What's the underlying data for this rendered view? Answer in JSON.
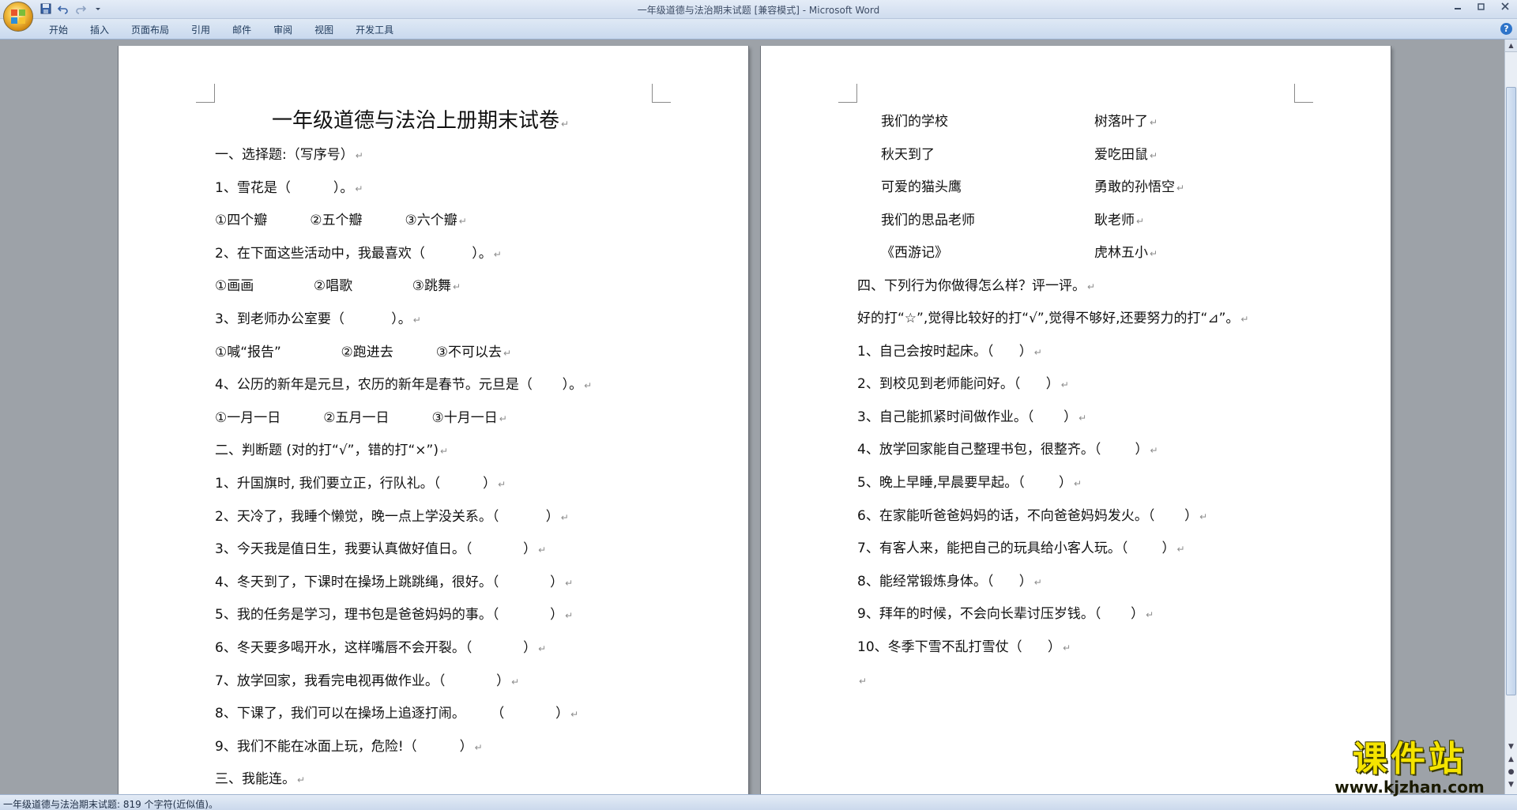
{
  "window": {
    "title": "一年级道德与法治期末试题 [兼容模式] - Microsoft Word",
    "help": "?"
  },
  "ribbon": {
    "tabs": [
      "开始",
      "插入",
      "页面布局",
      "引用",
      "邮件",
      "审阅",
      "视图",
      "开发工具"
    ]
  },
  "document": {
    "title": "一年级道德与法治上册期末试卷",
    "left_lines": [
      "一、选择题:（写序号）",
      "1、雪花是（          ）。",
      "①四个瓣          ②五个瓣          ③六个瓣",
      "2、在下面这些活动中，我最喜欢（           ）。",
      "①画画              ②唱歌              ③跳舞",
      "3、到老师办公室要（           ）。",
      "①喊“报告”              ②跑进去          ③不可以去",
      "4、公历的新年是元旦，农历的新年是春节。元旦是（       ）。",
      "①一月一日          ②五月一日          ③十月一日",
      "二、判断题 (对的打“√”，错的打“×”)",
      "1、升国旗时, 我们要立正，行队礼。（          ）",
      "2、天冷了，我睡个懒觉，晚一点上学没关系。（           ）",
      "3、今天我是值日生，我要认真做好值日。（            ）",
      "4、冬天到了，下课时在操场上跳跳绳，很好。（            ）",
      "5、我的任务是学习，理书包是爸爸妈妈的事。（            ）",
      "6、冬天要多喝开水，这样嘴唇不会开裂。（            ）",
      "7、放学回家，我看完电视再做作业。（            ）",
      "8、下课了，我们可以在操场上追逐打闹。      （            ）",
      "9、我们不能在冰面上玩，危险!（          ）",
      "三、我能连。"
    ],
    "matching": [
      {
        "left": "我们的学校",
        "right": "树落叶了"
      },
      {
        "left": "秋天到了",
        "right": "爱吃田鼠"
      },
      {
        "left": "可爱的猫头鹰",
        "right": "勇敢的孙悟空"
      },
      {
        "left": "我们的思品老师",
        "right": "耿老师"
      },
      {
        "left": "《西游记》",
        "right": "虎林五小"
      }
    ],
    "right_lines": [
      "四、下列行为你做得怎么样？评一评。",
      "好的打“☆”,觉得比较好的打“√”,觉得不够好,还要努力的打“⊿”。",
      "1、自己会按时起床。（      ）",
      "2、到校见到老师能问好。（      ）",
      "3、自己能抓紧时间做作业。（       ）",
      "4、放学回家能自己整理书包，很整齐。（        ）",
      "5、晚上早睡,早晨要早起。（        ）",
      "6、在家能听爸爸妈妈的话，不向爸爸妈妈发火。（       ）",
      "7、有客人来，能把自己的玩具给小客人玩。（        ）",
      "8、能经常锻炼身体。（      ）",
      "9、拜年的时候，不会向长辈讨压岁钱。（       ）",
      "10、冬季下雪不乱打雪仗（      ）",
      ""
    ]
  },
  "status": {
    "text": "一年级道德与法治期末试题: 819 个字符(近似值)。"
  },
  "watermark": {
    "main": "课件站",
    "url": "www.kjzhan.com"
  },
  "icons": {
    "office": "office-button-icon",
    "save": "save-icon",
    "undo": "undo-icon",
    "redo": "redo-icon",
    "customize": "customize-qat-icon",
    "help": "help-icon"
  }
}
